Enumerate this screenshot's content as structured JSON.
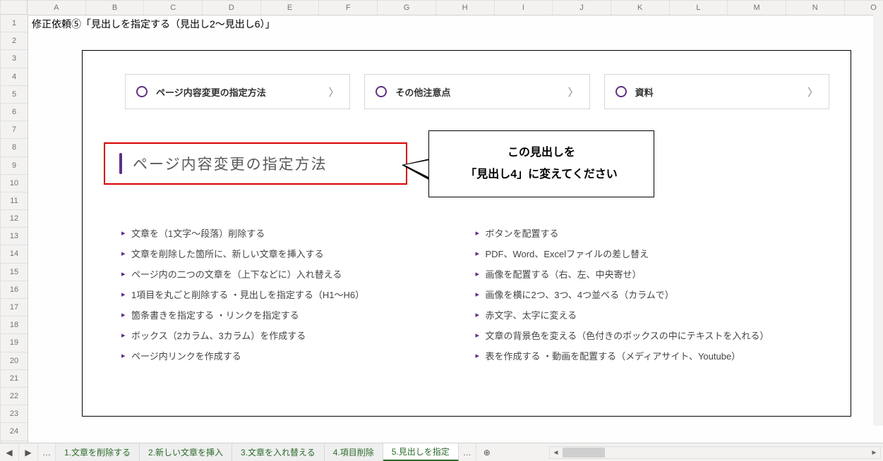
{
  "columns": [
    "A",
    "B",
    "C",
    "D",
    "E",
    "F",
    "G",
    "H",
    "I",
    "J",
    "K",
    "L",
    "M",
    "N",
    "O"
  ],
  "rows": [
    "1",
    "2",
    "3",
    "4",
    "5",
    "6",
    "7",
    "8",
    "9",
    "10",
    "11",
    "12",
    "13",
    "14",
    "15",
    "16",
    "17",
    "18",
    "19",
    "20",
    "21",
    "22",
    "23",
    "24"
  ],
  "cell_a1": "修正依頼⑤「見出しを指定する（見出し2～見出し6）」",
  "nav_cards": [
    {
      "label": "ページ内容変更の指定方法"
    },
    {
      "label": "その他注意点"
    },
    {
      "label": "資料"
    }
  ],
  "heading": "ページ内容変更の指定方法",
  "callout": {
    "line1": "この見出しを",
    "line2": "「見出し4」に変えてください"
  },
  "list_left": [
    "文章を（1文字～段落）削除する",
    "文章を削除した箇所に、新しい文章を挿入する",
    "ページ内の二つの文章を（上下などに）入れ替える",
    "1項目を丸ごと削除する ・見出しを指定する（H1～H6）",
    "箇条書きを指定する ・リンクを指定する",
    "ボックス（2カラム、3カラム）を作成する",
    "ページ内リンクを作成する"
  ],
  "list_right": [
    "ボタンを配置する",
    "PDF、Word、Excelファイルの差し替え",
    "画像を配置する（右、左、中央寄せ）",
    "画像を横に2つ、3つ、4つ並べる（カラムで）",
    "赤文字、太字に変える",
    "文章の背景色を変える（色付きのボックスの中にテキストを入れる）",
    "表を作成する ・動画を配置する（メディアサイト、Youtube）"
  ],
  "sheet_tabs": [
    {
      "label": "1.文章を削除する",
      "active": false
    },
    {
      "label": "2.新しい文章を挿入",
      "active": false
    },
    {
      "label": "3.文章を入れ替える",
      "active": false
    },
    {
      "label": "4.項目削除",
      "active": false
    },
    {
      "label": "5.見出しを指定",
      "active": true
    }
  ],
  "glyphs": {
    "chev_right": "〉",
    "ellipsis": "…",
    "tri_left": "◀",
    "tri_right": "▶",
    "arrow_left": "◄",
    "arrow_right": "►",
    "plus": "⊕"
  }
}
